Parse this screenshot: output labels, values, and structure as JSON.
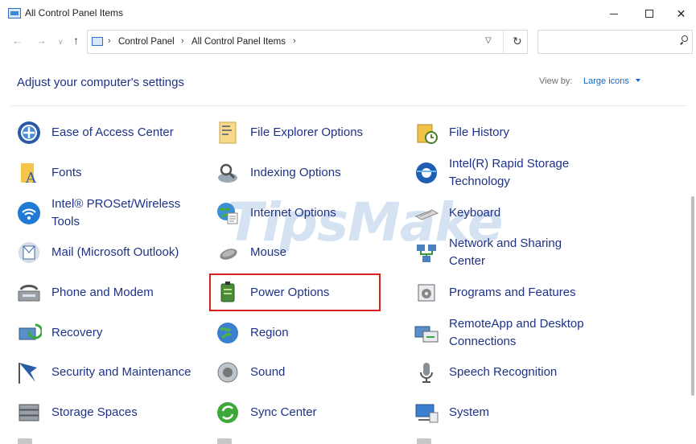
{
  "window": {
    "title": "All Control Panel Items"
  },
  "address": {
    "crumbs": [
      "Control Panel",
      "All Control Panel Items"
    ],
    "search_placeholder": ""
  },
  "header": {
    "heading": "Adjust your computer's settings",
    "view_by_label": "View by:",
    "view_by_value": "Large icons"
  },
  "watermark": "TipsMake",
  "items": [
    {
      "label": "Ease of Access Center",
      "icon": "ease-of-access-icon"
    },
    {
      "label": "File Explorer Options",
      "icon": "file-explorer-options-icon"
    },
    {
      "label": "File History",
      "icon": "file-history-icon"
    },
    {
      "label": "Fonts",
      "icon": "fonts-icon"
    },
    {
      "label": "Indexing Options",
      "icon": "indexing-options-icon"
    },
    {
      "label": "Intel(R) Rapid Storage Technology",
      "icon": "intel-rapid-storage-icon"
    },
    {
      "label": "Intel® PROSet/Wireless Tools",
      "icon": "intel-proset-wireless-icon"
    },
    {
      "label": "Internet Options",
      "icon": "internet-options-icon"
    },
    {
      "label": "Keyboard",
      "icon": "keyboard-icon"
    },
    {
      "label": "Mail (Microsoft Outlook)",
      "icon": "mail-icon"
    },
    {
      "label": "Mouse",
      "icon": "mouse-icon"
    },
    {
      "label": "Network and Sharing Center",
      "icon": "network-sharing-icon"
    },
    {
      "label": "Phone and Modem",
      "icon": "phone-modem-icon"
    },
    {
      "label": "Power Options",
      "icon": "power-options-icon"
    },
    {
      "label": "Programs and Features",
      "icon": "programs-features-icon"
    },
    {
      "label": "Recovery",
      "icon": "recovery-icon"
    },
    {
      "label": "Region",
      "icon": "region-icon"
    },
    {
      "label": "RemoteApp and Desktop Connections",
      "icon": "remoteapp-icon"
    },
    {
      "label": "Security and Maintenance",
      "icon": "security-maintenance-icon"
    },
    {
      "label": "Sound",
      "icon": "sound-icon"
    },
    {
      "label": "Speech Recognition",
      "icon": "speech-recognition-icon"
    },
    {
      "label": "Storage Spaces",
      "icon": "storage-spaces-icon"
    },
    {
      "label": "Sync Center",
      "icon": "sync-center-icon"
    },
    {
      "label": "System",
      "icon": "system-icon"
    }
  ],
  "colors": {
    "link_blue": "#1e3287",
    "highlight_red": "#d72020",
    "accent_blue": "#1666c5"
  }
}
